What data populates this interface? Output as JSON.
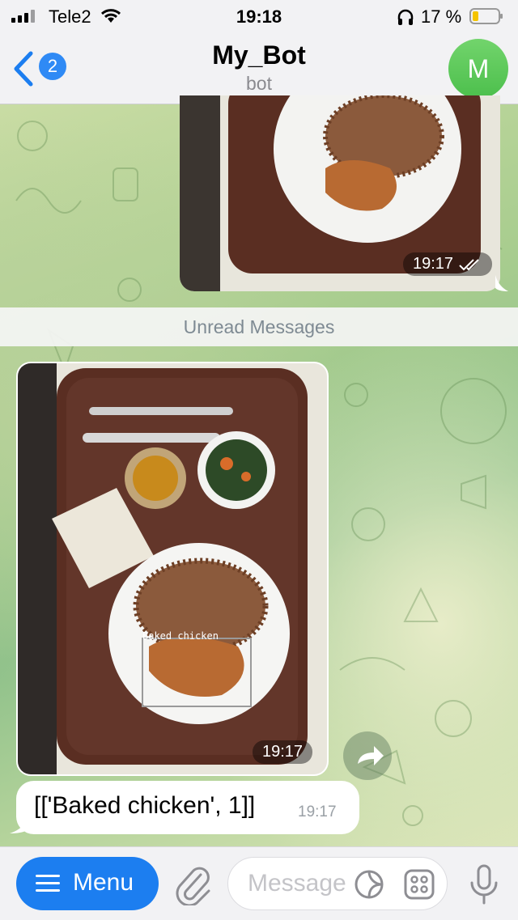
{
  "status_bar": {
    "carrier": "Tele2",
    "time": "19:18",
    "battery_percent": "17 %"
  },
  "header": {
    "back_badge": "2",
    "title": "My_Bot",
    "subtitle": "bot",
    "avatar_letter": "M"
  },
  "messages": {
    "outgoing_photo": {
      "time": "19:17",
      "status_icon": "double-check-icon"
    },
    "unread_divider": "Unread Messages",
    "incoming_photo": {
      "time": "19:17",
      "detection_label": "Baked chicken"
    },
    "incoming_text": {
      "text": "[['Baked chicken', 1]]",
      "time": "19:17"
    }
  },
  "input_bar": {
    "menu_label": "Menu",
    "placeholder": "Message"
  },
  "colors": {
    "accent": "#1c7ef0",
    "avatar": "#5cc95a",
    "tray": "#5a2e22"
  }
}
